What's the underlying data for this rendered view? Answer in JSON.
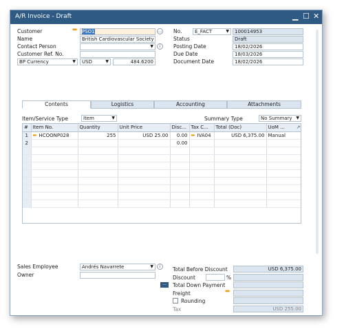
{
  "window": {
    "title": "A/R Invoice - Draft",
    "minimize": "▁",
    "maximize": "☐",
    "close": "✕"
  },
  "header_left": {
    "customer_label": "Customer",
    "customer_value": "PSO1",
    "name_label": "Name",
    "name_value": "British Cardiovascular Society",
    "contact_label": "Contact Person",
    "contact_value": "",
    "ref_label": "Customer Ref. No.",
    "ref_value": "",
    "currency_select": "BP Currency",
    "currency_code": "USD",
    "rate": "484.6200"
  },
  "header_right": {
    "no_label": "No.",
    "series": "E_FACT",
    "number": "100014953",
    "status_label": "Status",
    "status_value": "Draft",
    "posting_label": "Posting Date",
    "posting_value": "18/02/2026",
    "due_label": "Due Date",
    "due_value": "18/03/2026",
    "doc_label": "Document Date",
    "doc_value": "18/02/2026"
  },
  "tabs": [
    "Contents",
    "Logistics",
    "Accounting",
    "Attachments"
  ],
  "contents": {
    "item_type_label": "Item/Service Type",
    "item_type_value": "Item",
    "summary_label": "Summary Type",
    "summary_value": "No Summary"
  },
  "grid": {
    "columns": [
      "#",
      "Item No.",
      "Quantity",
      "Unit Price",
      "Disc...",
      "Tax C...",
      "Total (Doc)",
      "UoM ..."
    ],
    "rows": [
      {
        "n": "1",
        "item": "HCOONP028",
        "qty": "255",
        "price": "USD 25.00",
        "disc": "0.00",
        "tax": "IVA04",
        "total": "USD 6,375.00",
        "uom": "Manual"
      },
      {
        "n": "2",
        "item": "",
        "qty": "",
        "price": "",
        "disc": "0.00",
        "tax": "",
        "total": "",
        "uom": ""
      }
    ]
  },
  "footer_left": {
    "sales_label": "Sales Employee",
    "sales_value": "Andrés Navarrete",
    "owner_label": "Owner",
    "owner_value": ""
  },
  "footer_right": {
    "total_before_label": "Total Before Discount",
    "total_before_value": "USD 6,375.00",
    "discount_label": "Discount",
    "discount_pct_sign": "%",
    "down_payment_label": "Total Down Payment",
    "down_payment_button": "...",
    "freight_label": "Freight",
    "rounding_label": "Rounding",
    "tax_label": "Tax",
    "tax_value": "USD 255.00"
  },
  "colors": {
    "titlebar": "#2e5a83",
    "field_readonly": "#dbe5ef",
    "link_arrow": "#e8a020"
  }
}
